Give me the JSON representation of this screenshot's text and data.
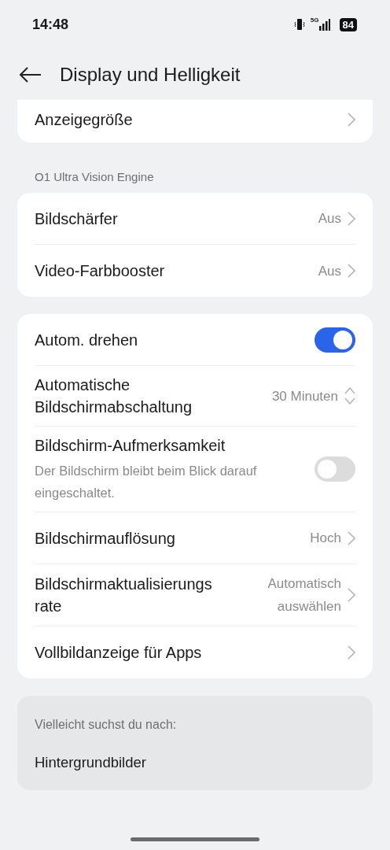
{
  "status_bar": {
    "time": "14:48",
    "network": "5G",
    "battery": "84"
  },
  "header": {
    "title": "Display und Helligkeit"
  },
  "groups": [
    {
      "rows": [
        {
          "kind": "link",
          "title": "Anzeigegröße"
        }
      ]
    },
    {
      "section": "O1 Ultra Vision Engine",
      "rows": [
        {
          "kind": "link",
          "title": "Bildschärfer",
          "value": "Aus"
        },
        {
          "kind": "link",
          "title": "Video-Farbbooster",
          "value": "Aus"
        }
      ]
    },
    {
      "rows": [
        {
          "kind": "toggle",
          "title": "Autom. drehen",
          "on": true
        },
        {
          "kind": "stepper",
          "title": "Automatische Bildschirmabschaltung",
          "value": "30 Minuten"
        },
        {
          "kind": "toggle",
          "title": "Bildschirm-Aufmerksamkeit",
          "subtitle": "Der Bildschirm bleibt beim Blick darauf eingeschaltet.",
          "on": false
        },
        {
          "kind": "link",
          "title": "Bildschirmauflösung",
          "value": "Hoch"
        },
        {
          "kind": "link",
          "title": "Bildschirmaktualisierungs rate",
          "value": "Automatisch auswählen"
        },
        {
          "kind": "link",
          "title": "Vollbildanzeige für Apps"
        }
      ]
    }
  ],
  "suggestions": {
    "heading": "Vielleicht suchst du nach:",
    "items": [
      "Hintergrundbilder"
    ]
  }
}
